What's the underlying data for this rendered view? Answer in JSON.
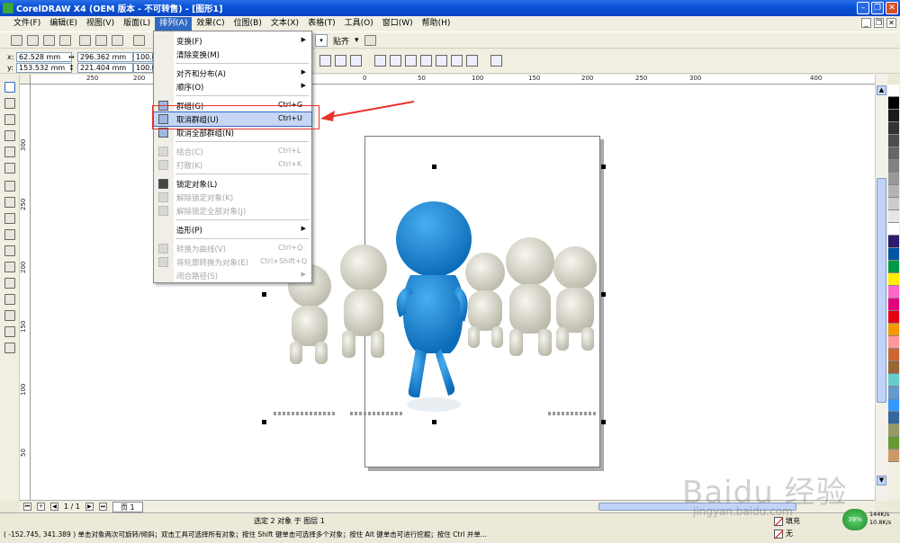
{
  "window": {
    "title": "CorelDRAW X4 (OEM 版本 - 不可转售) - [图形1]"
  },
  "menubar": {
    "items": [
      "文件(F)",
      "编辑(E)",
      "视图(V)",
      "版面(L)",
      "排列(A)",
      "效果(C)",
      "位图(B)",
      "文本(X)",
      "表格(T)",
      "工具(O)",
      "窗口(W)",
      "帮助(H)"
    ],
    "active_index": 4
  },
  "toolbar": {
    "snap_label": "贴齐"
  },
  "propbar": {
    "x_label": "x:",
    "x_value": "62.528 mm",
    "y_label": "y:",
    "y_value": "153.532 mm",
    "w_value": "296.362 mm",
    "h_value": "221.404 mm",
    "scale_x": "100.0",
    "scale_y": "100.0"
  },
  "ruler": {
    "top_labels": [
      "250",
      "200",
      "150",
      "100",
      "50",
      "0",
      "50",
      "100",
      "150",
      "200",
      "250",
      "300",
      "400"
    ],
    "left_labels": [
      "300",
      "250",
      "200",
      "150",
      "100",
      "50"
    ],
    "unit": "毫米"
  },
  "arrange_menu": {
    "items": [
      {
        "label": "变换(F)",
        "shortcut": "",
        "submenu": true,
        "disabled": false,
        "icon": ""
      },
      {
        "label": "清除变换(M)",
        "shortcut": "",
        "submenu": false,
        "disabled": false,
        "icon": ""
      },
      {
        "sep": true
      },
      {
        "label": "对齐和分布(A)",
        "shortcut": "",
        "submenu": true,
        "disabled": false,
        "icon": ""
      },
      {
        "label": "顺序(O)",
        "shortcut": "",
        "submenu": true,
        "disabled": false,
        "icon": ""
      },
      {
        "sep": true
      },
      {
        "label": "群组(G)",
        "shortcut": "Ctrl+G",
        "submenu": false,
        "disabled": false,
        "icon": "group-icon"
      },
      {
        "label": "取消群组(U)",
        "shortcut": "Ctrl+U",
        "submenu": false,
        "disabled": false,
        "icon": "ungroup-icon",
        "highlighted": true
      },
      {
        "label": "取消全部群组(N)",
        "shortcut": "",
        "submenu": false,
        "disabled": false,
        "icon": "ungroup-all-icon"
      },
      {
        "sep": true
      },
      {
        "label": "结合(C)",
        "shortcut": "Ctrl+L",
        "submenu": false,
        "disabled": true,
        "icon": "combine-icon"
      },
      {
        "label": "打散(K)",
        "shortcut": "Ctrl+K",
        "submenu": false,
        "disabled": true,
        "icon": "break-apart-icon"
      },
      {
        "sep": true
      },
      {
        "label": "锁定对象(L)",
        "shortcut": "",
        "submenu": false,
        "disabled": false,
        "icon": "lock-icon"
      },
      {
        "label": "解除锁定对象(K)",
        "shortcut": "",
        "submenu": false,
        "disabled": true,
        "icon": "unlock-icon"
      },
      {
        "label": "解除锁定全部对象(J)",
        "shortcut": "",
        "submenu": false,
        "disabled": true,
        "icon": "unlock-all-icon"
      },
      {
        "sep": true
      },
      {
        "label": "造形(P)",
        "shortcut": "",
        "submenu": true,
        "disabled": false,
        "icon": ""
      },
      {
        "sep": true
      },
      {
        "label": "转换为曲线(V)",
        "shortcut": "Ctrl+Q",
        "submenu": false,
        "disabled": true,
        "icon": "convert-curves-icon"
      },
      {
        "label": "将轮廓转换为对象(E)",
        "shortcut": "Ctrl+Shift+Q",
        "submenu": false,
        "disabled": true,
        "icon": "outline-to-object-icon"
      },
      {
        "label": "闭合路径(S)",
        "shortcut": "",
        "submenu": true,
        "disabled": true,
        "icon": ""
      }
    ]
  },
  "docnav": {
    "page_count": "1 / 1",
    "page_tab": "页 1"
  },
  "status": {
    "selection": "选定 2 对象 于 图层 1",
    "hint": "( -152.745, 341.389 )  单击对象两次可旋转/倾斜；双击工具可选择所有对象；按住 Shift 键单击可选择多个对象；按住 Alt 键单击可进行挖掘；按住 Ctrl 并单...",
    "fill_label": "填充",
    "outline_label": "无",
    "net_percent": "39%",
    "net_up": "144K/s",
    "net_down": "10.8K/s"
  },
  "watermark": {
    "text": "Baidu 经验",
    "sub": "jingyan.baidu.com"
  },
  "colors": {
    "accent": "#316ac5",
    "figure_blue": "#1e88d9",
    "annotation_red": "#e8342e",
    "palette": [
      "#ffffff",
      "#000000",
      "#1a1a1a",
      "#333333",
      "#4d4d4d",
      "#666666",
      "#808080",
      "#999999",
      "#b3b3b3",
      "#cccccc",
      "#e6e6e6",
      "#ffffff",
      "#2e1a6e",
      "#0055a5",
      "#009944",
      "#ffee00",
      "#ff66cc",
      "#e4007f",
      "#e60012",
      "#f39800",
      "#ff9999",
      "#cc6633",
      "#996633",
      "#66cccc",
      "#6699cc",
      "#3399ff",
      "#336699",
      "#999966",
      "#669933",
      "#cc9966"
    ]
  }
}
